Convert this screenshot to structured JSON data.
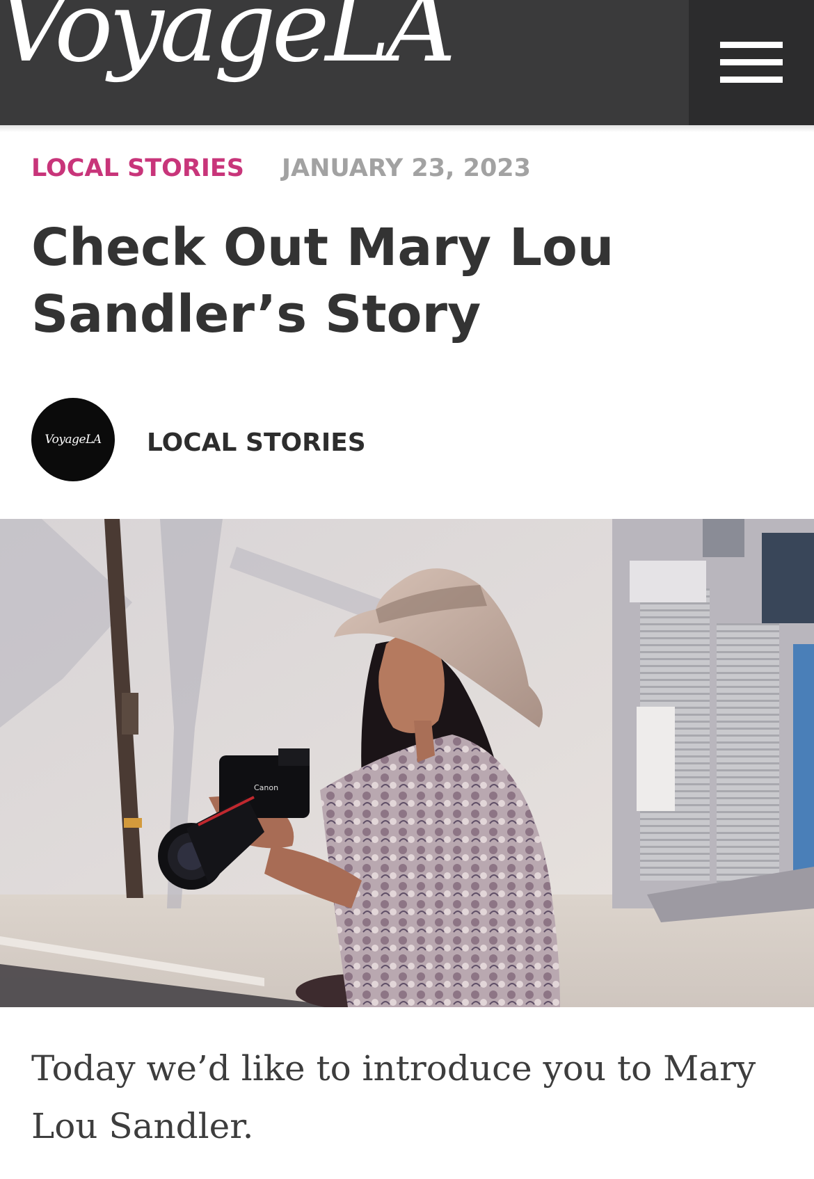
{
  "header": {
    "logo_text": "VoyageLA",
    "menu_icon": "hamburger-menu-icon",
    "background_color": "#3a3a3b",
    "menu_box_color": "#2c2c2d"
  },
  "article": {
    "category": "LOCAL STORIES",
    "date": "JANUARY 23, 2023",
    "title": "Check Out Mary Lou Sandler’s Story",
    "author_avatar_text": "VoyageLA",
    "author": "LOCAL STORIES",
    "intro": "Today we’d like to introduce you to Mary Lou Sandler.",
    "category_color": "#c8357a",
    "date_color": "#a2a2a2"
  },
  "hero_image": {
    "subject": "photo of a woman in a sun hat holding a camera on a city street"
  }
}
